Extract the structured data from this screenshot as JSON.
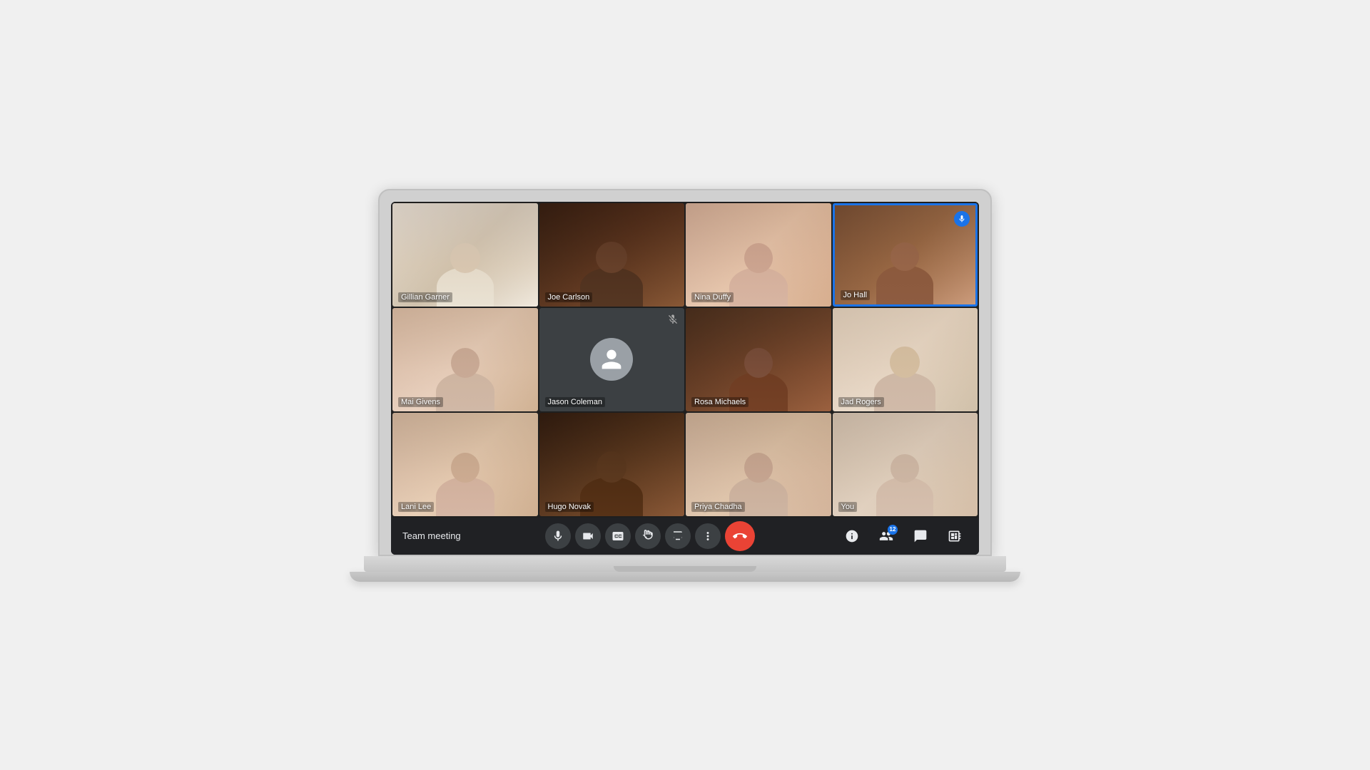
{
  "meeting": {
    "title": "Team meeting"
  },
  "participants": [
    {
      "id": "gillian",
      "name": "Gillian Garner",
      "row": 0,
      "col": 0,
      "has_video": true,
      "is_muted": false,
      "is_speaking": false
    },
    {
      "id": "joe",
      "name": "Joe Carlson",
      "row": 0,
      "col": 1,
      "has_video": true,
      "is_muted": false,
      "is_speaking": false
    },
    {
      "id": "nina",
      "name": "Nina Duffy",
      "row": 0,
      "col": 2,
      "has_video": true,
      "is_muted": false,
      "is_speaking": false
    },
    {
      "id": "jo",
      "name": "Jo Hall",
      "row": 0,
      "col": 3,
      "has_video": true,
      "is_muted": false,
      "is_speaking": true
    },
    {
      "id": "mai",
      "name": "Mai Givens",
      "row": 1,
      "col": 0,
      "has_video": true,
      "is_muted": false,
      "is_speaking": false
    },
    {
      "id": "jason",
      "name": "Jason Coleman",
      "row": 1,
      "col": 1,
      "has_video": false,
      "is_muted": true,
      "is_speaking": false
    },
    {
      "id": "rosa",
      "name": "Rosa Michaels",
      "row": 1,
      "col": 2,
      "has_video": true,
      "is_muted": false,
      "is_speaking": false
    },
    {
      "id": "jad",
      "name": "Jad Rogers",
      "row": 1,
      "col": 3,
      "has_video": true,
      "is_muted": false,
      "is_speaking": false
    },
    {
      "id": "lani",
      "name": "Lani Lee",
      "row": 2,
      "col": 0,
      "has_video": true,
      "is_muted": false,
      "is_speaking": false
    },
    {
      "id": "hugo",
      "name": "Hugo Novak",
      "row": 2,
      "col": 1,
      "has_video": true,
      "is_muted": false,
      "is_speaking": false
    },
    {
      "id": "priya",
      "name": "Priya Chadha",
      "row": 2,
      "col": 2,
      "has_video": true,
      "is_muted": false,
      "is_speaking": false
    },
    {
      "id": "you",
      "name": "You",
      "row": 2,
      "col": 3,
      "has_video": true,
      "is_muted": false,
      "is_speaking": false
    }
  ],
  "controls": {
    "microphone_label": "Microphone",
    "camera_label": "Camera",
    "captions_label": "Captions",
    "hand_label": "Raise hand",
    "present_label": "Present",
    "more_label": "More options",
    "end_call_label": "End call",
    "info_label": "Meeting info",
    "people_label": "People",
    "chat_label": "Chat",
    "activities_label": "Activities",
    "people_count": "12"
  }
}
